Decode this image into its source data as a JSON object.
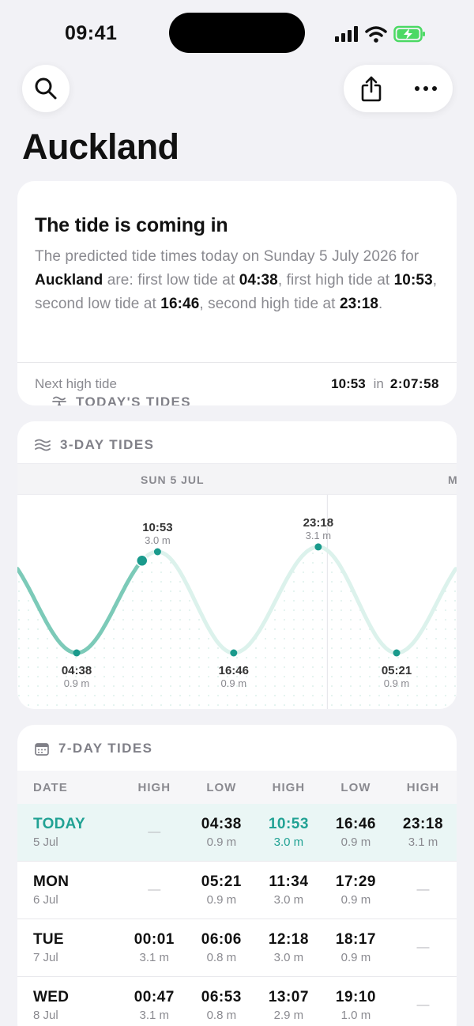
{
  "status": {
    "time": "09:41"
  },
  "page": {
    "title": "Auckland"
  },
  "today": {
    "header": "TODAY'S TIDES",
    "headline": "The tide is coming in",
    "desc": [
      {
        "t": "The predicted tide times today on Sunday 5 July 2026 for ",
        "b": false
      },
      {
        "t": "Auckland",
        "b": true
      },
      {
        "t": " are: first low tide at ",
        "b": false
      },
      {
        "t": "04:38",
        "b": true
      },
      {
        "t": ", first high tide at ",
        "b": false
      },
      {
        "t": "10:53",
        "b": true
      },
      {
        "t": ", second low tide at ",
        "b": false
      },
      {
        "t": "16:46",
        "b": true
      },
      {
        "t": ", second high tide at ",
        "b": false
      },
      {
        "t": "23:18",
        "b": true
      },
      {
        "t": ".",
        "b": false
      }
    ],
    "next_label": "Next high tide",
    "next_time": "10:53",
    "next_in": "in",
    "countdown": "2:07:58"
  },
  "three_day": {
    "header": "3-DAY TIDES",
    "day1": "SUN 5 JUL",
    "day2": "M",
    "extremes": [
      {
        "time": "04:38",
        "height": "0.9 m",
        "type": "low"
      },
      {
        "time": "10:53",
        "height": "3.0 m",
        "type": "high"
      },
      {
        "time": "16:46",
        "height": "0.9 m",
        "type": "low"
      },
      {
        "time": "23:18",
        "height": "3.1 m",
        "type": "high"
      },
      {
        "time": "05:21",
        "height": "0.9 m",
        "type": "low"
      }
    ],
    "colors": {
      "past": "#7ccab8",
      "future": "#dcf2ec",
      "dot": "#1a9a8c",
      "now": "#1a9a8c"
    }
  },
  "seven_day": {
    "header": "7-DAY TIDES",
    "columns": [
      "DATE",
      "HIGH",
      "LOW",
      "HIGH",
      "LOW",
      "HIGH"
    ],
    "rows": [
      {
        "day": "TODAY",
        "date": "5 Jul",
        "today": true,
        "cells": [
          {
            "time": "",
            "height": "",
            "dash": "—"
          },
          {
            "time": "04:38",
            "height": "0.9 m",
            "dash": ""
          },
          {
            "time": "10:53",
            "height": "3.0 m",
            "dash": "",
            "accent": true
          },
          {
            "time": "16:46",
            "height": "0.9 m",
            "dash": ""
          },
          {
            "time": "23:18",
            "height": "3.1 m",
            "dash": ""
          }
        ]
      },
      {
        "day": "MON",
        "date": "6 Jul",
        "today": false,
        "cells": [
          {
            "time": "",
            "height": "",
            "dash": "—"
          },
          {
            "time": "05:21",
            "height": "0.9 m",
            "dash": ""
          },
          {
            "time": "11:34",
            "height": "3.0 m",
            "dash": ""
          },
          {
            "time": "17:29",
            "height": "0.9 m",
            "dash": ""
          },
          {
            "time": "",
            "height": "",
            "dash": "—"
          }
        ]
      },
      {
        "day": "TUE",
        "date": "7 Jul",
        "today": false,
        "cells": [
          {
            "time": "00:01",
            "height": "3.1 m",
            "dash": ""
          },
          {
            "time": "06:06",
            "height": "0.8 m",
            "dash": ""
          },
          {
            "time": "12:18",
            "height": "3.0 m",
            "dash": ""
          },
          {
            "time": "18:17",
            "height": "0.9 m",
            "dash": ""
          },
          {
            "time": "",
            "height": "",
            "dash": "—"
          }
        ]
      },
      {
        "day": "WED",
        "date": "8 Jul",
        "today": false,
        "cells": [
          {
            "time": "00:47",
            "height": "3.1 m",
            "dash": ""
          },
          {
            "time": "06:53",
            "height": "0.8 m",
            "dash": ""
          },
          {
            "time": "13:07",
            "height": "2.9 m",
            "dash": ""
          },
          {
            "time": "19:10",
            "height": "1.0 m",
            "dash": ""
          },
          {
            "time": "",
            "height": "",
            "dash": "—"
          }
        ]
      }
    ]
  }
}
